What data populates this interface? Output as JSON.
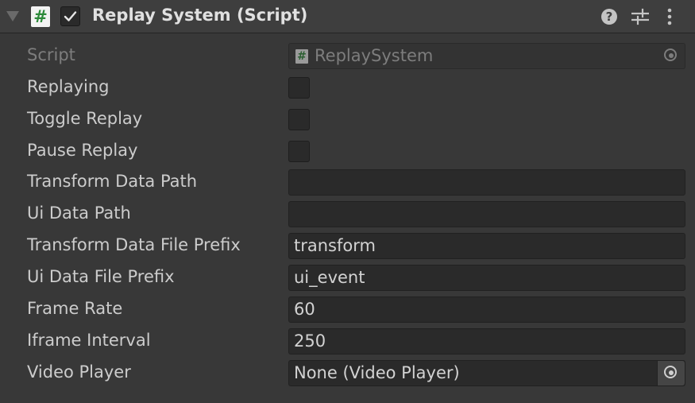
{
  "component": {
    "title": "Replay System (Script)",
    "enabled": true,
    "icons": {
      "foldout": "foldout-triangle-icon",
      "script": "csharp-script-icon",
      "help": "help-icon",
      "presets": "presets-sliders-icon",
      "menu": "kebab-menu-icon"
    },
    "script_icon_glyph": "#",
    "help_glyph": "?"
  },
  "fields": [
    {
      "label": "Script",
      "type": "object",
      "value": "ReplaySystem",
      "disabled": true
    },
    {
      "label": "Replaying",
      "type": "checkbox",
      "checked": false
    },
    {
      "label": "Toggle Replay",
      "type": "checkbox",
      "checked": false
    },
    {
      "label": "Pause Replay",
      "type": "checkbox",
      "checked": false
    },
    {
      "label": "Transform Data Path",
      "type": "text",
      "value": ""
    },
    {
      "label": "Ui Data Path",
      "type": "text",
      "value": ""
    },
    {
      "label": "Transform Data File Prefix",
      "type": "text",
      "value": "transform"
    },
    {
      "label": "Ui Data File Prefix",
      "type": "text",
      "value": "ui_event"
    },
    {
      "label": "Frame Rate",
      "type": "text",
      "value": "60"
    },
    {
      "label": "Iframe Interval",
      "type": "text",
      "value": "250"
    },
    {
      "label": "Video Player",
      "type": "object",
      "value": "None (Video Player)"
    }
  ],
  "colors": {
    "background": "#383838",
    "header": "#3e3e3e",
    "field": "#2a2a2a",
    "script_green": "#2d8a3a"
  }
}
